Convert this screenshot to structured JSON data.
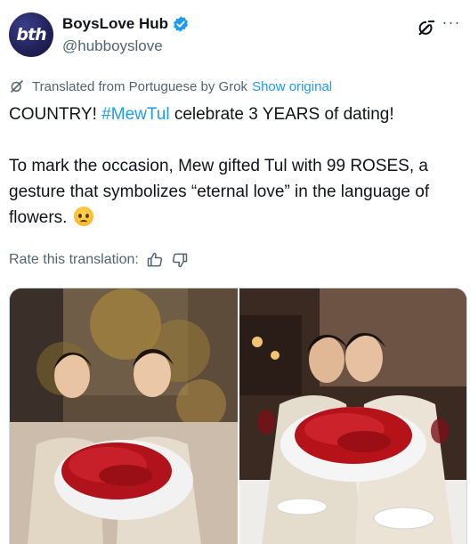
{
  "author": {
    "avatar_text": "bth",
    "display_name": "BoysLove Hub",
    "handle": "@hubboyslove",
    "verified": true
  },
  "header_icons": {
    "grok": "grok-icon",
    "more": "more-icon",
    "more_glyph": "···"
  },
  "translation": {
    "label": "Translated from Portuguese by Grok",
    "show_original": "Show original"
  },
  "tweet": {
    "line1_before": "COUNTRY! ",
    "hashtag": "#MewTul",
    "line1_after": " celebrate 3 YEARS of dating!",
    "paragraph2": "To mark the occasion, Mew gifted Tul with 99 ROSES, a gesture that symbolizes “eternal love” in the language of flowers.",
    "emoji": "pleading-face-emoji"
  },
  "rate": {
    "label": "Rate this translation:",
    "up_icon": "thumbs-up-icon",
    "down_icon": "thumbs-down-icon"
  },
  "colors": {
    "accent": "#1d9bf0",
    "text": "#0f1419",
    "muted": "#536471",
    "rose": "#c0141c"
  }
}
